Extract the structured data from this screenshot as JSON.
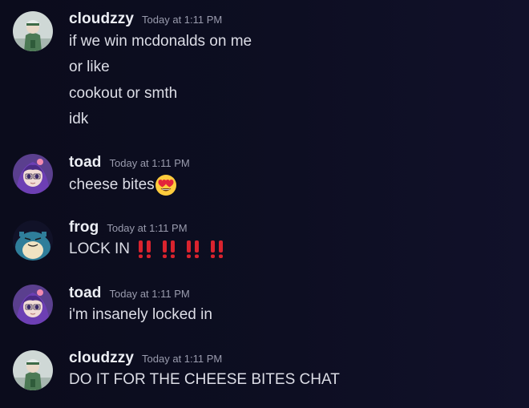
{
  "messages": [
    {
      "user": "cloudzzy",
      "timestamp": "Today at 1:11 PM",
      "avatar_icon": "cloudzzy-avatar-icon",
      "lines": [
        "if we win mcdonalds on me",
        "or like",
        "cookout or smth",
        "idk"
      ]
    },
    {
      "user": "toad",
      "timestamp": "Today at 1:11 PM",
      "avatar_icon": "toad-avatar-icon",
      "lines": [
        "cheese bites"
      ],
      "emoji": "heart-eyes-emoji"
    },
    {
      "user": "frog",
      "timestamp": "Today at 1:11 PM",
      "avatar_icon": "frog-avatar-icon",
      "lines": [
        "LOCK IN"
      ],
      "emoji": "double-exclamation-emoji",
      "emoji_count": 4
    },
    {
      "user": "toad",
      "timestamp": "Today at 1:11 PM",
      "avatar_icon": "toad-avatar-icon",
      "lines": [
        "i'm insanely locked in"
      ]
    },
    {
      "user": "cloudzzy",
      "timestamp": "Today at 1:11 PM",
      "avatar_icon": "cloudzzy-avatar-icon",
      "lines": [
        "DO IT FOR THE CHEESE BITES CHAT"
      ]
    }
  ],
  "colors": {
    "background": "#0d0e22",
    "username": "#eceef4",
    "timestamp": "#9a9cae",
    "message_text": "#dcdde6",
    "exclamation_red": "#d9232e"
  }
}
